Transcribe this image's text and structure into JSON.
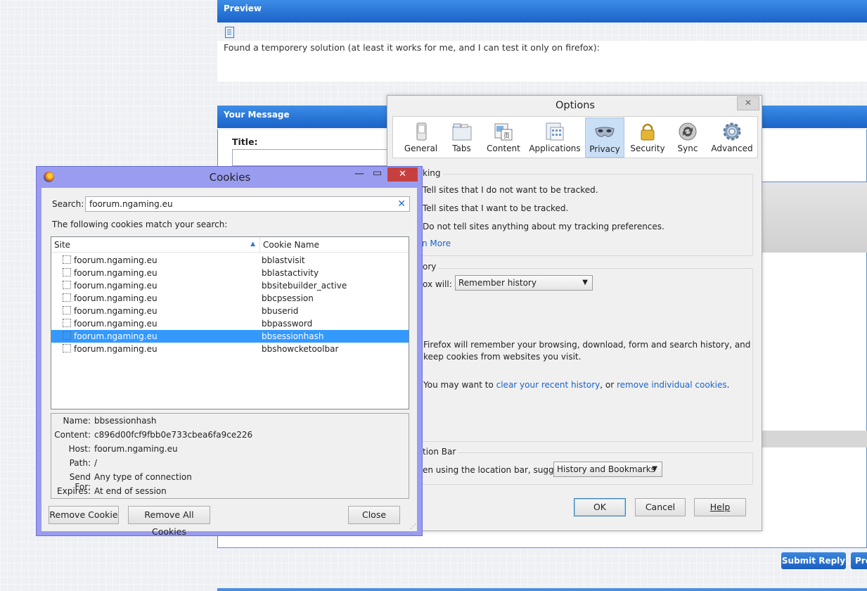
{
  "forum": {
    "preview_title": "Preview",
    "preview_text": "Found a temporery solution (at least it works for me, and I can test it only on firefox):",
    "your_message_title": "Your Message",
    "title_label": "Title:",
    "submit_reply": "Submit Reply",
    "preview_button_cut": "Pre"
  },
  "options": {
    "window_title": "Options",
    "close_glyph": "✕",
    "tabs": [
      {
        "label": "General",
        "icon": "general-switch-icon"
      },
      {
        "label": "Tabs",
        "icon": "tabs-icon"
      },
      {
        "label": "Content",
        "icon": "content-icon"
      },
      {
        "label": "Applications",
        "icon": "applications-icon"
      },
      {
        "label": "Privacy",
        "icon": "privacy-mask-icon",
        "selected": true
      },
      {
        "label": "Security",
        "icon": "padlock-icon"
      },
      {
        "label": "Sync",
        "icon": "sync-icon"
      },
      {
        "label": "Advanced",
        "icon": "gear-icon"
      }
    ],
    "tracking": {
      "group_title": "king",
      "opt1": "Tell sites that I do not want to be tracked.",
      "opt2": "Tell sites that I want to be tracked.",
      "opt3": "Do not tell sites anything about my tracking preferences.",
      "learn_more": "n More"
    },
    "history": {
      "group_title": "ory",
      "will_label": "ox will:",
      "will_value": "Remember history",
      "desc_line1": "Firefox will remember your browsing, download, form and search history, and",
      "desc_line2": "keep cookies from websites you visit.",
      "may_want": "You may want to ",
      "clear_link": "clear your recent history",
      "or_text": ", or ",
      "remove_link": "remove individual cookies",
      "period": "."
    },
    "location": {
      "group_title": "tion Bar",
      "suggest_label": "en using the location bar, suggest:",
      "suggest_value": "History and Bookmarks"
    },
    "buttons": {
      "ok": "OK",
      "cancel": "Cancel",
      "help": "Help"
    }
  },
  "cookies": {
    "window_title": "Cookies",
    "search_label": "Search:",
    "search_value": "foorum.ngaming.eu",
    "match_text": "The following cookies match your search:",
    "columns": {
      "site": "Site",
      "name": "Cookie Name"
    },
    "rows": [
      {
        "site": "foorum.ngaming.eu",
        "name": "bblastvisit"
      },
      {
        "site": "foorum.ngaming.eu",
        "name": "bblastactivity"
      },
      {
        "site": "foorum.ngaming.eu",
        "name": "bbsitebuilder_active"
      },
      {
        "site": "foorum.ngaming.eu",
        "name": "bbcpsession"
      },
      {
        "site": "foorum.ngaming.eu",
        "name": "bbuserid"
      },
      {
        "site": "foorum.ngaming.eu",
        "name": "bbpassword"
      },
      {
        "site": "foorum.ngaming.eu",
        "name": "bbsessionhash",
        "selected": true
      },
      {
        "site": "foorum.ngaming.eu",
        "name": "bbshowcketoolbar"
      }
    ],
    "details": {
      "name_label": "Name:",
      "name_value": "bbsessionhash",
      "content_label": "Content:",
      "content_value": "c896d00fcf9fbb0e733cbea6fa9ce226",
      "host_label": "Host:",
      "host_value": "foorum.ngaming.eu",
      "path_label": "Path:",
      "path_value": "/",
      "sendfor_label": "Send For:",
      "sendfor_value": "Any type of connection",
      "expires_label": "Expires:",
      "expires_value": "At end of session"
    },
    "buttons": {
      "remove": "Remove Cookie",
      "remove_all": "Remove All Cookies",
      "close": "Close"
    }
  },
  "colors": {
    "forum_blue": "#1a63c8",
    "selection": "#3399ff",
    "cookies_frame": "#9a9cf0",
    "close_red": "#c74040"
  }
}
